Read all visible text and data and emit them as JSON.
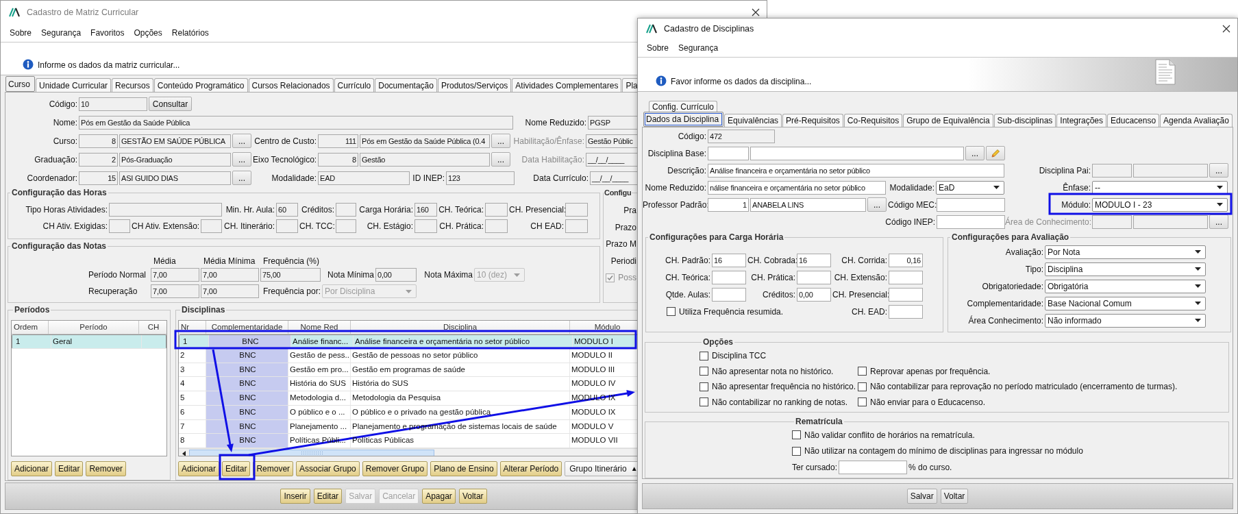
{
  "main_window": {
    "title": "Cadastro de Matriz Curricular",
    "menu": [
      "Sobre",
      "Segurança",
      "Favoritos",
      "Opções",
      "Relatórios"
    ],
    "info": "Informe os dados da matriz curricular...",
    "tabs": [
      {
        "label": "Curso",
        "selected": true
      },
      {
        "label": "Unidade Curricular",
        "selected": false
      },
      {
        "label": "Recursos",
        "selected": false
      },
      {
        "label": "Conteúdo Programático",
        "selected": false
      },
      {
        "label": "Cursos Relacionados",
        "selected": false
      },
      {
        "label": "Currículo",
        "selected": false
      },
      {
        "label": "Documentação",
        "selected": false
      },
      {
        "label": "Produtos/Serviços",
        "selected": false
      },
      {
        "label": "Atividades Complementares",
        "selected": false
      },
      {
        "label": "Pla",
        "selected": false
      }
    ],
    "course_rows": [
      [
        {
          "kind": "label",
          "text": "Código:"
        },
        {
          "kind": "field",
          "value": "10",
          "readonly": true
        },
        {
          "kind": "button",
          "label": "Consultar"
        }
      ],
      [
        {
          "kind": "label",
          "text": "Nome:"
        },
        {
          "kind": "field",
          "value": "Pós em Gestão da Saúde Pública",
          "readonly": true
        },
        {
          "kind": "label",
          "text": "Nome Reduzido:"
        },
        {
          "kind": "field",
          "value": "PGSP",
          "readonly": true
        }
      ],
      [
        {
          "kind": "label",
          "text": "Curso:"
        },
        {
          "kind": "num",
          "value": "8",
          "readonly": true
        },
        {
          "kind": "field",
          "value": "GESTÃO EM SAÚDE PÚBLICA",
          "readonly": true
        },
        {
          "kind": "button",
          "label": "..."
        },
        {
          "kind": "label",
          "text": "Centro de Custo:"
        },
        {
          "kind": "num",
          "value": "111",
          "readonly": true
        },
        {
          "kind": "field",
          "value": "Pós em Gestão da Saúde Pública (0.4",
          "readonly": true
        },
        {
          "kind": "button",
          "label": "..."
        },
        {
          "kind": "label",
          "text": "Habilitação/Ênfase:",
          "disabled": true
        },
        {
          "kind": "field",
          "value": "Gestão Públic",
          "readonly": true
        }
      ],
      [
        {
          "kind": "label",
          "text": "Graduação:"
        },
        {
          "kind": "num",
          "value": "2",
          "readonly": true
        },
        {
          "kind": "field",
          "value": "Pós-Graduação",
          "readonly": true
        },
        {
          "kind": "button",
          "label": "..."
        },
        {
          "kind": "label",
          "text": "Eixo Tecnológico:"
        },
        {
          "kind": "num",
          "value": "8",
          "readonly": true
        },
        {
          "kind": "field",
          "value": "Gestão",
          "readonly": true
        },
        {
          "kind": "button",
          "label": "..."
        },
        {
          "kind": "label",
          "text": "Data Habilitação:",
          "disabled": true
        },
        {
          "kind": "field",
          "value": "__/__/____",
          "readonly": true
        }
      ],
      [
        {
          "kind": "label",
          "text": "Coordenador:"
        },
        {
          "kind": "num",
          "value": "15",
          "readonly": true
        },
        {
          "kind": "field",
          "value": "ASI GUIDO DIAS",
          "readonly": true
        },
        {
          "kind": "button",
          "label": "..."
        },
        {
          "kind": "label",
          "text": "Modalidade:"
        },
        {
          "kind": "field",
          "value": "EAD",
          "readonly": true
        },
        {
          "kind": "label",
          "text": "ID INEP:"
        },
        {
          "kind": "field",
          "value": "123",
          "readonly": true
        },
        {
          "kind": "label",
          "text": "Data Currículo:"
        },
        {
          "kind": "field",
          "value": "__/__/____",
          "readonly": true
        }
      ]
    ],
    "hours": {
      "title": "Configuração das Horas",
      "rows": [
        [
          {
            "kind": "label",
            "text": "Tipo Horas Atividades:"
          },
          {
            "kind": "field",
            "readonly": true
          },
          "",
          "",
          {
            "kind": "label",
            "text": "Min. Hr. Aula:"
          },
          {
            "kind": "field",
            "value": "60",
            "readonly": true
          },
          {
            "kind": "label",
            "text": "Créditos:"
          },
          {
            "kind": "field",
            "readonly": true
          },
          {
            "kind": "label",
            "text": "Carga Horária:"
          },
          {
            "kind": "field",
            "value": "160",
            "readonly": true
          },
          {
            "kind": "label",
            "text": "CH. Teórica:"
          },
          {
            "kind": "field",
            "readonly": true
          },
          {
            "kind": "label",
            "text": "CH. Presencial:"
          },
          {
            "kind": "field",
            "readonly": true
          }
        ],
        [
          {
            "kind": "label",
            "text": "CH Ativ. Exigidas:"
          },
          {
            "kind": "field",
            "readonly": true
          },
          {
            "kind": "label",
            "text": "CH Ativ. Extensão:"
          },
          {
            "kind": "field",
            "readonly": true
          },
          {
            "kind": "label",
            "text": "CH. Itinerário:"
          },
          {
            "kind": "field",
            "readonly": true
          },
          {
            "kind": "label",
            "text": "CH. TCC:"
          },
          {
            "kind": "field",
            "readonly": true
          },
          {
            "kind": "label",
            "text": "CH. Estágio:"
          },
          {
            "kind": "field",
            "readonly": true
          },
          {
            "kind": "label",
            "text": "CH. Prática:"
          },
          {
            "kind": "field",
            "readonly": true
          },
          {
            "kind": "label",
            "text": "CH EAD:"
          },
          {
            "kind": "field",
            "readonly": true
          }
        ]
      ]
    },
    "grades": {
      "title": "Configuração das Notas",
      "headers": [
        "Média",
        "Média Mínima",
        "Frequência (%)"
      ],
      "rows": [
        [
          {
            "kind": "caption",
            "text": "Período Normal"
          },
          {
            "kind": "field",
            "value": "7,00",
            "readonly": true
          },
          {
            "kind": "field",
            "value": "7,00",
            "readonly": true
          },
          {
            "kind": "field",
            "value": "75,00",
            "readonly": true
          },
          {
            "kind": "label",
            "text": "Nota Mínima"
          },
          {
            "kind": "field",
            "value": "0,00",
            "readonly": true
          },
          {
            "kind": "label",
            "text": "Nota Máxima"
          },
          {
            "kind": "select",
            "value": "10 (dez)",
            "disabled": true
          }
        ],
        [
          {
            "kind": "caption",
            "text": "Recuperação"
          },
          {
            "kind": "field",
            "value": "7,00",
            "readonly": true
          },
          {
            "kind": "field",
            "value": "7,00",
            "readonly": true
          },
          {
            "kind": "label",
            "text": "Frequência por:"
          },
          {
            "kind": "select",
            "value": "Por Disciplina",
            "disabled": true
          }
        ]
      ]
    },
    "side_group": {
      "title": "Configu",
      "rows": [
        {
          "kind": "label",
          "text": "Pra"
        },
        {
          "kind": "label",
          "text": "Prazo"
        },
        {
          "kind": "label",
          "text": "Prazo M"
        },
        {
          "kind": "label",
          "text": "Periodi"
        },
        {
          "kind": "check",
          "text": "Poss",
          "checked": true,
          "disabled": true
        }
      ]
    },
    "periods": {
      "title": "Períodos",
      "columns": [
        "Ordem",
        "Período",
        "CH"
      ],
      "rows": [
        {
          "cells": [
            "1",
            "Geral"
          ],
          "selected": true
        }
      ],
      "buttons": [
        "Adicionar",
        "Editar",
        "Remover"
      ]
    },
    "disciplines": {
      "title": "Disciplinas",
      "columns": [
        "Nr",
        "Complementaridade",
        "Nome Red",
        "Disciplina",
        "Módulo"
      ],
      "rows": [
        {
          "cells": [
            "1",
            "BNC",
            "Análise financ...",
            "Análise financeira e orçamentária no setor público",
            "MODULO I"
          ],
          "selected": true
        },
        {
          "cells": [
            "2",
            "BNC",
            "Gestão de pess...",
            "Gestão de pessoas no setor público",
            "MODULO II"
          ],
          "selected": false
        },
        {
          "cells": [
            "3",
            "BNC",
            "Gestão em pro...",
            "Gestão em programas de saúde",
            "MODULO III"
          ],
          "selected": false
        },
        {
          "cells": [
            "4",
            "BNC",
            "História do SUS",
            "História do SUS",
            "MODULO IV"
          ],
          "selected": false
        },
        {
          "cells": [
            "5",
            "BNC",
            "Metodologia d...",
            "Metodologia da Pesquisa",
            "MODULO IX"
          ],
          "selected": false
        },
        {
          "cells": [
            "6",
            "BNC",
            "O público e o ...",
            "O público e o privado na gestão pública",
            "MODULO IX"
          ],
          "selected": false
        },
        {
          "cells": [
            "7",
            "BNC",
            "Planejamento ...",
            "Planejamento e programação de sistemas locais de saúde",
            "MODULO V"
          ],
          "selected": false
        },
        {
          "cells": [
            "8",
            "BNC",
            "Políticas Públi...",
            "Políticas Públicas",
            "MODULO VII"
          ],
          "selected": false
        }
      ],
      "buttons": [
        {
          "label": "Adicionar",
          "kind": "action"
        },
        {
          "label": "Editar",
          "kind": "action"
        },
        {
          "label": "Remover",
          "kind": "action"
        },
        {
          "label": "Associar Grupo",
          "kind": "action"
        },
        {
          "label": "Remover Grupo",
          "kind": "action"
        },
        {
          "label": "Plano de Ensino",
          "kind": "action"
        },
        {
          "label": "Alterar Período",
          "kind": "action"
        },
        {
          "label": "Grupo Itinerário",
          "kind": "menu",
          "arrow": "▲"
        }
      ]
    },
    "footer_buttons": [
      {
        "label": "Inserir",
        "disabled": false
      },
      {
        "label": "Editar",
        "disabled": false
      },
      {
        "label": "Salvar",
        "disabled": true
      },
      {
        "label": "Cancelar",
        "disabled": true
      },
      {
        "label": "Apagar",
        "disabled": false
      },
      {
        "label": "Voltar",
        "disabled": false
      }
    ]
  },
  "discipline_window": {
    "title": "Cadastro de Disciplinas",
    "menu": [
      "Sobre",
      "Segurança"
    ],
    "info": "Favor informe os dados da disciplina...",
    "tab_rows": [
      [
        {
          "label": "Config. Currículo",
          "selected": false
        }
      ],
      [
        {
          "label": "Dados da Disciplina",
          "selected": true
        },
        {
          "label": "Equivalências",
          "selected": false
        },
        {
          "label": "Pré-Requisitos",
          "selected": false
        },
        {
          "label": "Co-Requisitos",
          "selected": false
        },
        {
          "label": "Grupo de Equivalência",
          "selected": false
        },
        {
          "label": "Sub-disciplinas",
          "selected": false
        },
        {
          "label": "Integrações",
          "selected": false
        },
        {
          "label": "Educacenso",
          "selected": false
        },
        {
          "label": "Agenda Avaliação",
          "selected": false
        }
      ]
    ],
    "form_rows": [
      {
        "left": [
          {
            "kind": "label",
            "text": "Código:"
          },
          {
            "kind": "field",
            "value": "472",
            "readonly": true
          }
        ]
      },
      {
        "left": [
          {
            "kind": "label",
            "text": "Disciplina Base:"
          },
          {
            "kind": "field",
            "readonly": false
          },
          {
            "kind": "field",
            "readonly": false
          },
          {
            "kind": "button",
            "label": "..."
          },
          {
            "kind": "edit_button"
          }
        ]
      },
      {
        "left": [
          {
            "kind": "label",
            "text": "Descrição:"
          },
          {
            "kind": "field",
            "value": "Análise financeira e orçamentária no setor público",
            "readonly": false
          }
        ],
        "right": [
          {
            "kind": "label",
            "text": "Disciplina Pai:"
          },
          {
            "kind": "field",
            "readonly": true
          },
          {
            "kind": "field",
            "readonly": true
          },
          {
            "kind": "button",
            "label": "..."
          }
        ]
      },
      {
        "left": [
          {
            "kind": "label",
            "text": "Nome Reduzido:"
          },
          {
            "kind": "field",
            "value": "nálise financeira e orçamentária no setor público",
            "readonly": false
          },
          {
            "kind": "label",
            "text": "Modalidade:"
          },
          {
            "kind": "select",
            "value": "EaD",
            "disabled": false
          }
        ],
        "right": [
          {
            "kind": "label",
            "text": "Ênfase:"
          },
          {
            "kind": "select",
            "value": "--",
            "disabled": false
          }
        ]
      },
      {
        "left": [
          {
            "kind": "label",
            "text": "Professor Padrão:"
          },
          {
            "kind": "num",
            "value": "1",
            "readonly": false
          },
          {
            "kind": "field",
            "value": "ANABELA LINS",
            "readonly": false
          },
          {
            "kind": "button",
            "label": "..."
          },
          {
            "kind": "label",
            "text": "Código MEC:"
          },
          {
            "kind": "field",
            "readonly": false
          }
        ],
        "right": [
          {
            "kind": "label",
            "text": "Módulo:"
          },
          {
            "kind": "select",
            "value": "MODULO I - 23",
            "disabled": false
          }
        ]
      },
      {
        "left": [
          {
            "kind": "label",
            "text": "Código INEP:"
          },
          {
            "kind": "field",
            "readonly": false
          }
        ],
        "right": [
          {
            "kind": "label",
            "text": "Área de Conhecimento:",
            "disabled": true
          },
          {
            "kind": "field",
            "readonly": true
          },
          {
            "kind": "field",
            "readonly": true
          },
          {
            "kind": "button",
            "label": "..."
          }
        ]
      }
    ],
    "workload": {
      "title": "Configurações para Carga Horária",
      "rows": [
        [
          {
            "kind": "label",
            "text": "CH. Padrão:"
          },
          {
            "kind": "field",
            "value": "16",
            "readonly": false
          },
          {
            "kind": "label",
            "text": "CH. Cobrada:"
          },
          {
            "kind": "field",
            "value": "16",
            "readonly": false
          },
          {
            "kind": "label",
            "text": "CH. Corrida:"
          },
          {
            "kind": "num",
            "value": "0,16",
            "readonly": false
          }
        ],
        [
          {
            "kind": "label",
            "text": "CH. Teórica:"
          },
          {
            "kind": "field",
            "readonly": false
          },
          {
            "kind": "label",
            "text": "CH. Prática:"
          },
          {
            "kind": "field",
            "readonly": false
          },
          {
            "kind": "label",
            "text": "CH. Extensão:"
          },
          {
            "kind": "field",
            "readonly": false
          }
        ],
        [
          {
            "kind": "label",
            "text": "Qtde. Aulas:"
          },
          {
            "kind": "field",
            "readonly": false
          },
          {
            "kind": "label",
            "text": "Créditos:"
          },
          {
            "kind": "field",
            "value": "0,00",
            "readonly": false
          },
          {
            "kind": "label",
            "text": "CH. Presencial:"
          },
          {
            "kind": "field",
            "readonly": false
          }
        ],
        [
          {
            "kind": "check",
            "text": "Utiliza Frequência resumida.",
            "checked": false
          },
          "",
          "",
          "",
          {
            "kind": "label",
            "text": "CH. EAD:"
          },
          {
            "kind": "field",
            "readonly": false
          }
        ]
      ]
    },
    "evaluation": {
      "title": "Configurações para Avaliação",
      "rows": [
        [
          {
            "kind": "label",
            "text": "Avaliação:"
          },
          {
            "kind": "select",
            "value": "Por Nota",
            "disabled": false
          }
        ],
        [
          {
            "kind": "label",
            "text": "Tipo:"
          },
          {
            "kind": "select",
            "value": "Disciplina",
            "disabled": false
          }
        ],
        [
          {
            "kind": "label",
            "text": "Obrigatoriedade:"
          },
          {
            "kind": "select",
            "value": "Obrigatória",
            "disabled": false
          }
        ],
        [
          {
            "kind": "label",
            "text": "Complementaridade:"
          },
          {
            "kind": "select",
            "value": "Base Nacional Comum",
            "disabled": false
          }
        ],
        [
          {
            "kind": "label",
            "text": "Área Conhecimento:"
          },
          {
            "kind": "select",
            "value": "Não informado",
            "disabled": false
          }
        ]
      ]
    },
    "options": {
      "title": "Opções",
      "rows": [
        [
          {
            "kind": "check",
            "text": "Disciplina TCC",
            "checked": false
          }
        ],
        [
          {
            "kind": "check",
            "text": "Não apresentar nota no histórico.",
            "checked": false
          },
          {
            "kind": "check",
            "text": "Reprovar apenas por frequência.",
            "checked": false
          }
        ],
        [
          {
            "kind": "check",
            "text": "Não apresentar frequência no histórico.",
            "checked": false
          },
          {
            "kind": "check",
            "text": "Não contabilizar para reprovação no período matriculado (encerramento de turmas).",
            "checked": false
          }
        ],
        [
          {
            "kind": "check",
            "text": "Não contabilizar no ranking de notas.",
            "checked": false
          },
          {
            "kind": "check",
            "text": "Não enviar para o Educacenso.",
            "checked": false
          }
        ]
      ]
    },
    "reenrollment": {
      "title": "Rematrícula",
      "rows": [
        [
          {
            "kind": "check",
            "text": "Não validar conflito de horários na rematrícula.",
            "checked": false
          }
        ],
        [
          {
            "kind": "check",
            "text": "Não utilizar na contagem do mínimo de disciplinas para ingressar no módulo",
            "checked": false
          }
        ],
        [
          {
            "kind": "caption",
            "text": "Ter cursado:"
          },
          {
            "kind": "field",
            "readonly": false
          },
          {
            "kind": "caption",
            "text": "% do curso."
          }
        ]
      ]
    },
    "footer_buttons": [
      "Salvar",
      "Voltar"
    ]
  }
}
